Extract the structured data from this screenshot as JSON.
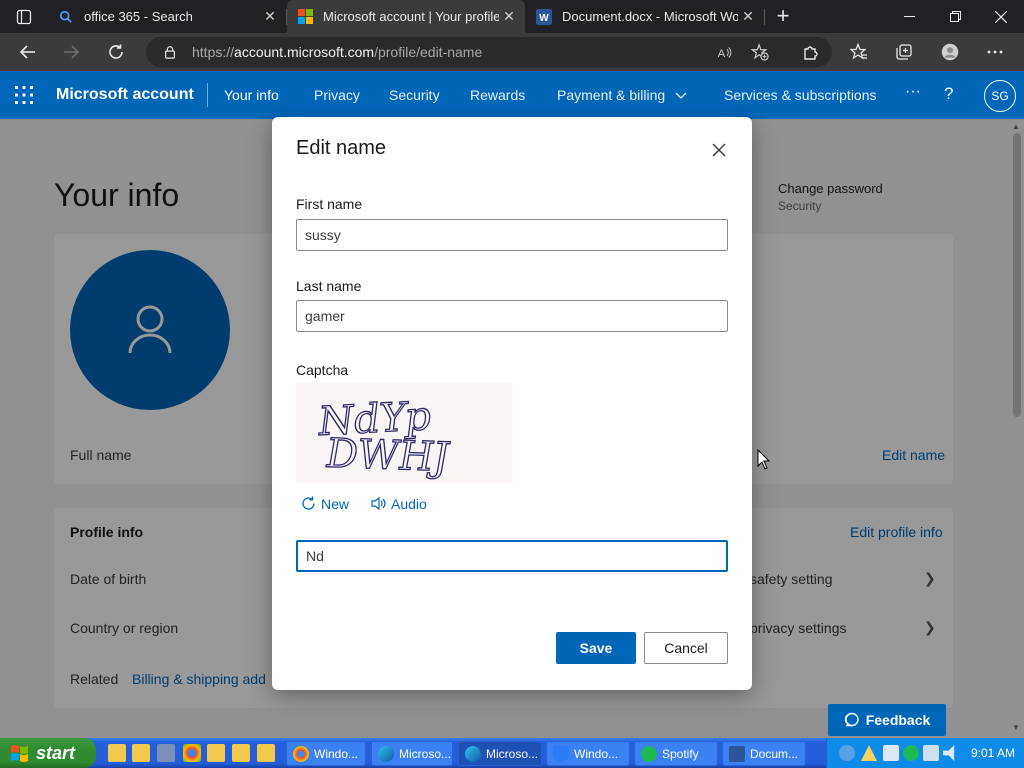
{
  "browser": {
    "tabs": [
      {
        "title": "office 365 - Search",
        "icon": "search-icon",
        "active": false
      },
      {
        "title": "Microsoft account | Your profile",
        "icon": "microsoft-logo-icon",
        "active": true
      },
      {
        "title": "Document.docx - Microsoft Word",
        "icon": "word-icon",
        "active": false
      }
    ],
    "tab_close": "✕",
    "new_tab": "+",
    "url_prefix": "https://",
    "url_domain": "account.microsoft.com",
    "url_path": "/profile/edit-name"
  },
  "msnav": {
    "brand": "Microsoft account",
    "items": [
      "Your info",
      "Privacy",
      "Security",
      "Rewards",
      "Payment & billing",
      "Services & subscriptions"
    ],
    "more": "···",
    "help": "?",
    "avatar_initials": "SG"
  },
  "page": {
    "title": "Your info",
    "full_name_label": "Full name",
    "edit_name_link": "Edit name",
    "change_password_title": "Change password",
    "change_password_sub": "Security",
    "profile_info_header": "Profile info",
    "edit_profile_info_link": "Edit profile info",
    "date_of_birth_label": "Date of birth",
    "country_label": "Country or region",
    "related_label": "Related",
    "billing_link": "Billing & shipping add",
    "safety_setting": "safety setting",
    "privacy_settings": "privacy settings",
    "feedback_label": "Feedback"
  },
  "dialog": {
    "title": "Edit name",
    "first_name_label": "First name",
    "first_name_value": "sussy",
    "last_name_label": "Last name",
    "last_name_value": "gamer",
    "captcha_label": "Captcha",
    "captcha_text_line1": "NdYp",
    "captcha_text_line2": "DWHJ",
    "new_label": "New",
    "audio_label": "Audio",
    "captcha_input_value": "Nd",
    "save_label": "Save",
    "cancel_label": "Cancel"
  },
  "taskbar": {
    "start_label": "start",
    "buttons": [
      {
        "label": "Windo...",
        "icon": "chrome-icon",
        "active": false
      },
      {
        "label": "Microso...",
        "icon": "edge-icon",
        "active": false
      },
      {
        "label": "Microso...",
        "icon": "edge-icon",
        "active": true
      },
      {
        "label": "Windo...",
        "icon": "shield-icon",
        "active": false
      },
      {
        "label": "Spotify",
        "icon": "spotify-icon",
        "active": false
      },
      {
        "label": "Docum...",
        "icon": "word-icon",
        "active": false
      }
    ],
    "clock": "9:01 AM"
  },
  "colors": {
    "ms_blue": "#0067b8",
    "browser_dark": "#202124",
    "xp_taskbar": "#245edb",
    "xp_start": "#2f8b2f"
  }
}
